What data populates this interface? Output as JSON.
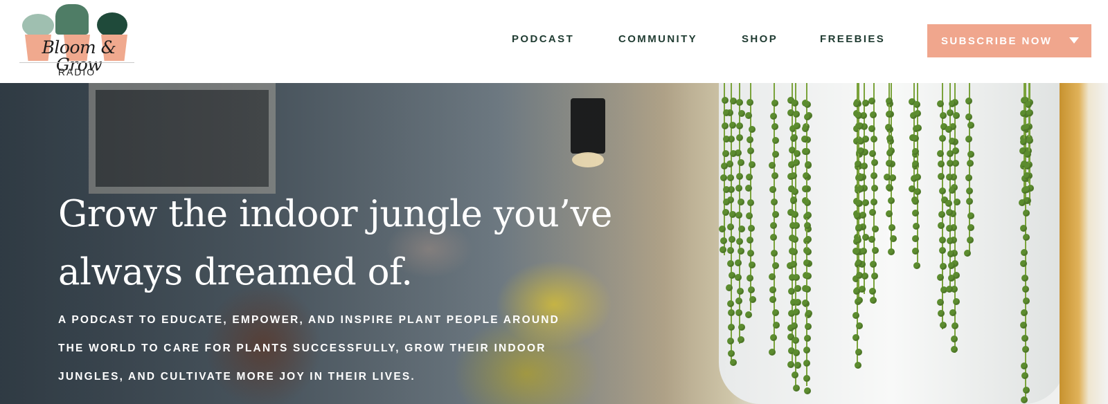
{
  "logo": {
    "wordmark": "Bloom & Grow",
    "subtitle": "RADIO",
    "icon": "succulent-pots-icon",
    "colors": {
      "pot": "#f0a98e",
      "leaf_light": "#9fbfb0",
      "leaf_dark": "#1f4a3a"
    }
  },
  "nav": {
    "items": [
      {
        "label": "PODCAST"
      },
      {
        "label": "COMMUNITY"
      },
      {
        "label": "SHOP"
      },
      {
        "label": "FREEBIES"
      }
    ],
    "subscribe_label": "SUBSCRIBE NOW",
    "subscribe_icon": "caret-down-icon",
    "colors": {
      "nav_text": "#1f3b31",
      "button_bg": "#f0a68d",
      "button_text": "#ffffff"
    }
  },
  "hero": {
    "headline_line1": "Grow the indoor jungle you’ve",
    "headline_line2": "always dreamed of.",
    "tagline_line1": "A PODCAST TO EDUCATE, EMPOWER, AND INSPIRE PLANT PEOPLE AROUND",
    "tagline_line2": "THE WORLD TO CARE FOR PLANTS SUCCESSFULLY, GROW THEIR INDOOR",
    "tagline_line3": "JUNGLES, AND CULTIVATE MORE JOY IN THEIR LIVES.",
    "image": "blurred-indoor-scene-with-hanging-string-of-pearls-plant"
  }
}
